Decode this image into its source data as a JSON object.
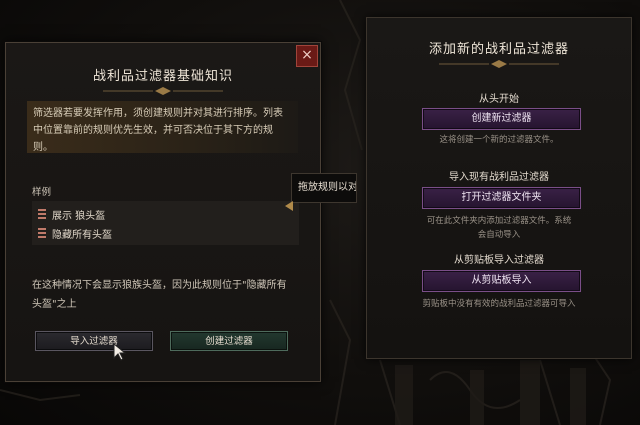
{
  "dialog": {
    "title": "战利品过滤器基础知识",
    "close_icon": "×",
    "info_text": "筛选器若要发挥作用，须创建规则并对其进行排序。列表中位置靠前的规则优先生效，并可否决位于其下方的规则。",
    "example_label": "样例",
    "rules": [
      {
        "label": "展示 狼头盔"
      },
      {
        "label": "隐藏所有头盔"
      }
    ],
    "description": "在这种情况下会显示狼族头盔，因为此规则位于\"隐藏所有头盔\"之上",
    "import_button": "导入过滤器",
    "create_button": "创建过滤器"
  },
  "tooltip": {
    "text": "拖放规则以对其"
  },
  "panel": {
    "title": "添加新的战利品过滤器",
    "sections": [
      {
        "heading": "从头开始",
        "button": "创建新过滤器",
        "note": "这将创建一个新的过滤器文件。"
      },
      {
        "heading": "导入现有战利品过滤器",
        "button": "打开过滤器文件夹",
        "note": "可在此文件夹内添加过滤器文件。系统会自动导入"
      },
      {
        "heading": "从剪贴板导入过滤器",
        "button": "从剪贴板导入",
        "note": "剪贴板中没有有效的战利品过滤器可导入"
      }
    ]
  },
  "colors": {
    "accent_gold": "#b08a4a",
    "purple_button": "#3a2146",
    "close_red": "#6a1a16",
    "create_green": "#23382f"
  }
}
